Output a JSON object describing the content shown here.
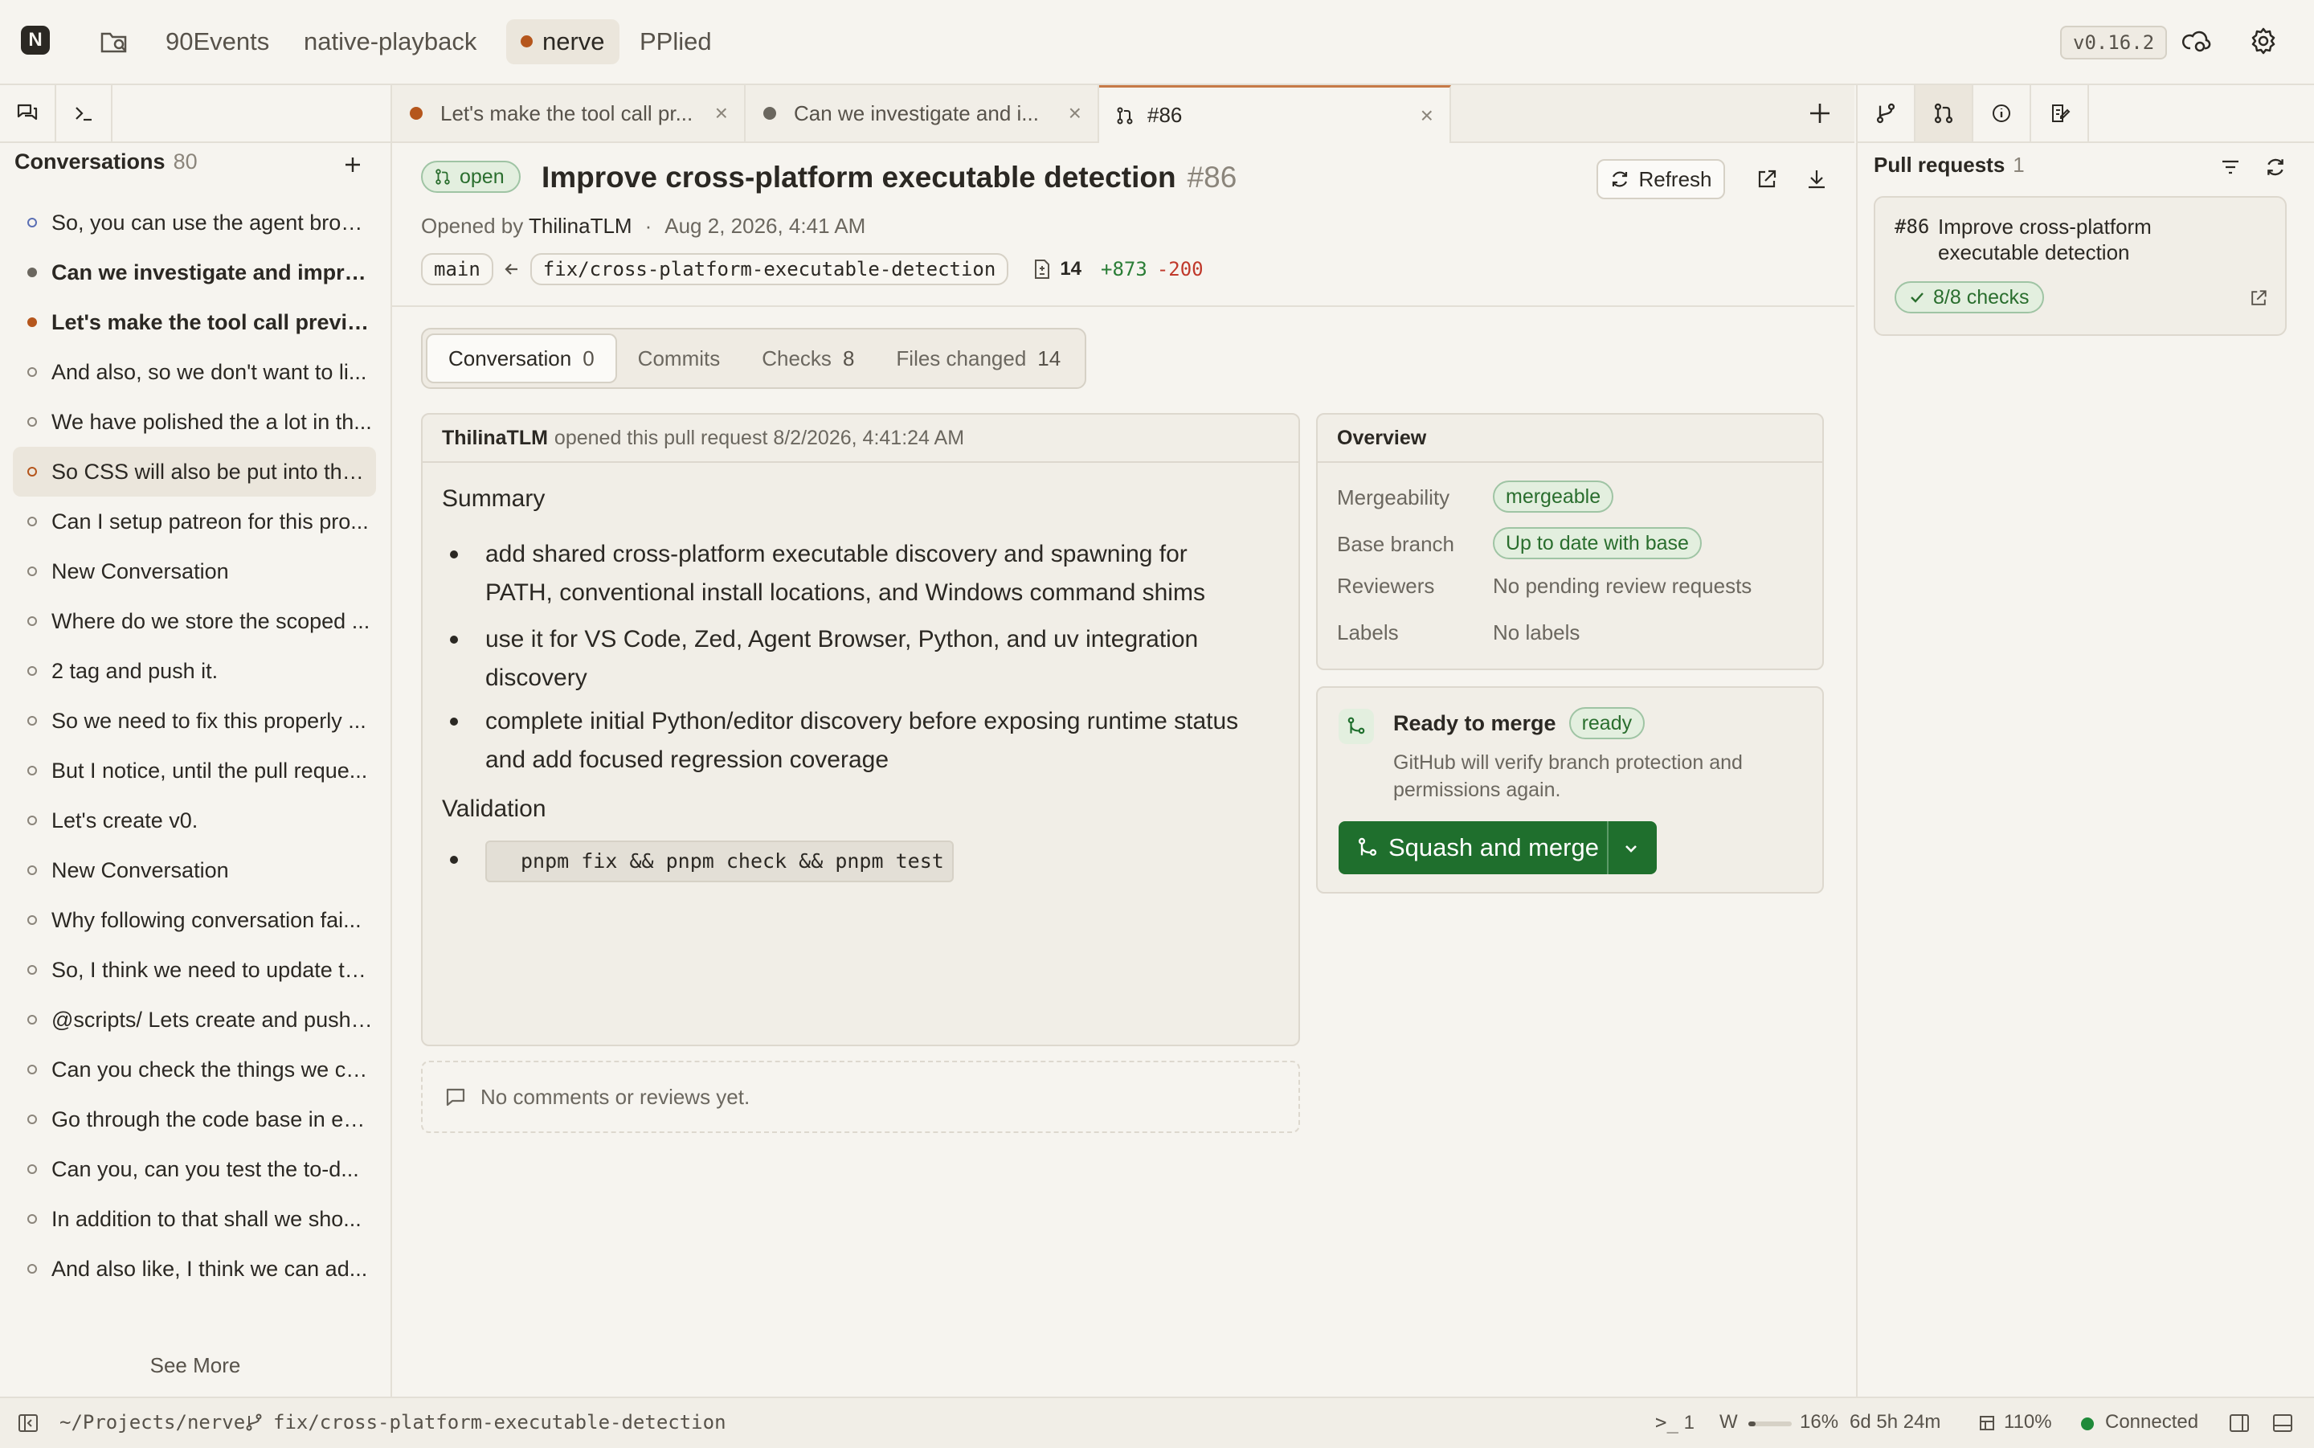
{
  "topbar": {
    "logo": "N",
    "workspaces": [
      "90Events",
      "native-playback",
      "nerve",
      "PPlied"
    ],
    "active_workspace": "nerve",
    "version": "v0.16.2"
  },
  "left_panel": {
    "title": "Conversations",
    "count": "80",
    "items": [
      "So, you can use the agent brow...",
      "Can we investigate and improv...",
      "Let's make the tool call preview...",
      "And also, so we don't want to li...",
      "We have polished the a lot in th...",
      "So CSS will also be put into the ...",
      "Can I setup patreon for this pro...",
      "New Conversation",
      "Where do we store the scoped ...",
      "2 tag and push it.",
      "So we need to fix this properly ...",
      "But I notice, until the pull reque...",
      "Let's create v0.",
      "New Conversation",
      "Why following conversation fai...",
      "So, I think we need to update th...",
      "@scripts/ Lets create and push ...",
      "Can you check the things we ca...",
      "Go through the code base in ea...",
      "Can you, can you test the to-d...",
      "In addition to that shall we sho...",
      "And also like, I think we can ad..."
    ],
    "see_more": "See More"
  },
  "tabs": [
    {
      "label": "Let's make the tool call pr..."
    },
    {
      "label": "Can we investigate and i..."
    },
    {
      "label": "#86"
    }
  ],
  "pr": {
    "state": "open",
    "title": "Improve cross-platform executable detection",
    "number": "#86",
    "refresh_label": "Refresh",
    "opened_by_prefix": "Opened by",
    "author": "ThilinaTLM",
    "sep": "·",
    "date": "Aug 2, 2026, 4:41 AM",
    "base": "main",
    "head": "fix/cross-platform-executable-detection",
    "files": "14",
    "additions": "+873",
    "deletions": "-200"
  },
  "subtabs": [
    {
      "label": "Conversation",
      "count": "0"
    },
    {
      "label": "Commits",
      "count": ""
    },
    {
      "label": "Checks",
      "count": "8"
    },
    {
      "label": "Files changed",
      "count": "14"
    }
  ],
  "body_card": {
    "author": "ThilinaTLM",
    "action": "opened this pull request 8/2/2026, 4:41:24 AM",
    "summary_heading": "Summary",
    "bullets": [
      [
        "add shared cross-platform executable discovery and spawning for",
        "PATH, conventional install locations, and Windows command shims"
      ],
      [
        "use it for VS Code, Zed, Agent Browser, Python, and uv integration",
        "discovery"
      ],
      [
        "complete initial Python/editor discovery before exposing runtime status",
        "and add focused regression coverage"
      ]
    ],
    "validation_heading": "Validation",
    "validation_cmd": "pnpm fix && pnpm check && pnpm test"
  },
  "no_comments": "No comments or reviews yet.",
  "overview": {
    "title": "Overview",
    "mergeability_label": "Mergeability",
    "mergeability_value": "mergeable",
    "base_label": "Base branch",
    "base_value": "Up to date with base",
    "reviewers_label": "Reviewers",
    "reviewers_value": "No pending review requests",
    "labels_label": "Labels",
    "labels_value": "No labels"
  },
  "merge": {
    "title": "Ready to merge",
    "badge": "ready",
    "desc_line1": "GitHub will verify branch protection and",
    "desc_line2": "permissions again.",
    "button": "Squash and merge"
  },
  "right_panel": {
    "title": "Pull requests",
    "count": "1",
    "pr_number": "#86",
    "pr_title_line1": "Improve cross-platform",
    "pr_title_line2": "executable detection",
    "checks": "8/8 checks"
  },
  "statusbar": {
    "path": "~/Projects/nerve",
    "branch": "fix/cross-platform-executable-detection",
    "terminals": "1",
    "w_label": "W",
    "usage_fraction": 0.16,
    "usage": "16%",
    "reset": "6d 5h 24m",
    "zoom": "110%",
    "connection": "Connected"
  },
  "colors": {
    "accent_green": "#1f6f2d",
    "status_orange": "#b5561c",
    "conn_green": "#1f8a3a"
  }
}
